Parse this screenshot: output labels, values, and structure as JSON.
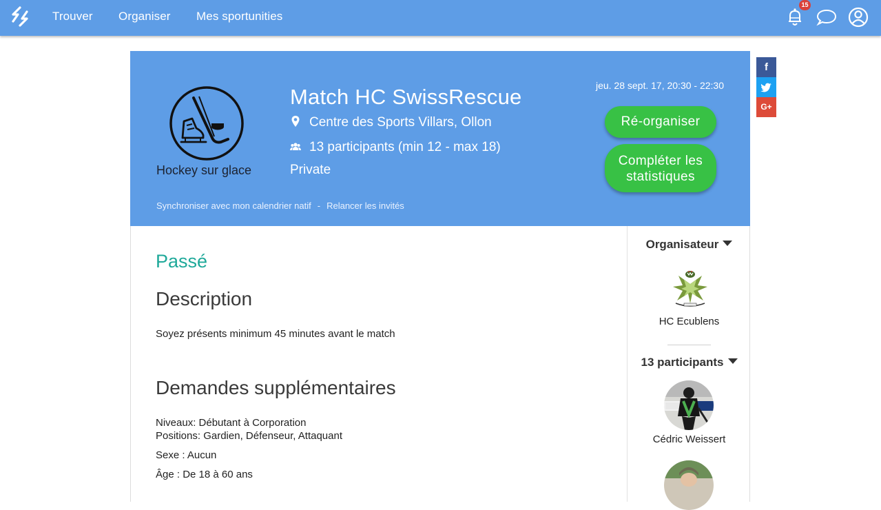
{
  "nav": {
    "items": [
      "Trouver",
      "Organiser",
      "Mes sportunities"
    ],
    "notification_count": "15"
  },
  "event": {
    "sport_label": "Hockey sur glace",
    "title": "Match HC SwissRescue",
    "location": "Centre des Sports Villars, Ollon",
    "participants": "13 participants (min 12 - max 18)",
    "privacy": "Private",
    "date": "jeu. 28 sept. 17, 20:30 - 22:30",
    "reorganize_button": "Ré-organiser",
    "stats_button_line1": "Compléter les",
    "stats_button_line2": "statistiques",
    "sync_link": "Synchroniser avec mon calendrier natif",
    "link_separator": "-",
    "remind_link": "Relancer les invités"
  },
  "share": {
    "facebook": "f",
    "google": "G+"
  },
  "details": {
    "status": "Passé",
    "description_heading": "Description",
    "description_text": "Soyez présents minimum 45 minutes avant le match",
    "extra_heading": "Demandes supplémentaires",
    "levels": "Niveaux: Débutant à Corporation",
    "positions": "Positions: Gardien, Défenseur, Attaquant",
    "sex": "Sexe : Aucun",
    "age": "Âge : De 18 à 60 ans"
  },
  "sidebar": {
    "organizer_heading": "Organisateur",
    "organizer_name": "HC Ecublens",
    "participants_heading": "13 participants",
    "participants": [
      {
        "name": "Cédric Weissert"
      }
    ]
  },
  "colors": {
    "brand_blue": "#5e9de6",
    "action_green": "#38c145",
    "status_teal": "#1fa99a",
    "badge_red": "#d9413a"
  },
  "icons": [
    "logo-icon",
    "bell-icon",
    "chat-icon",
    "user-icon",
    "hockey-icon",
    "map-pin-icon",
    "group-icon",
    "facebook-icon",
    "twitter-icon",
    "google-plus-icon",
    "caret-down-icon"
  ]
}
